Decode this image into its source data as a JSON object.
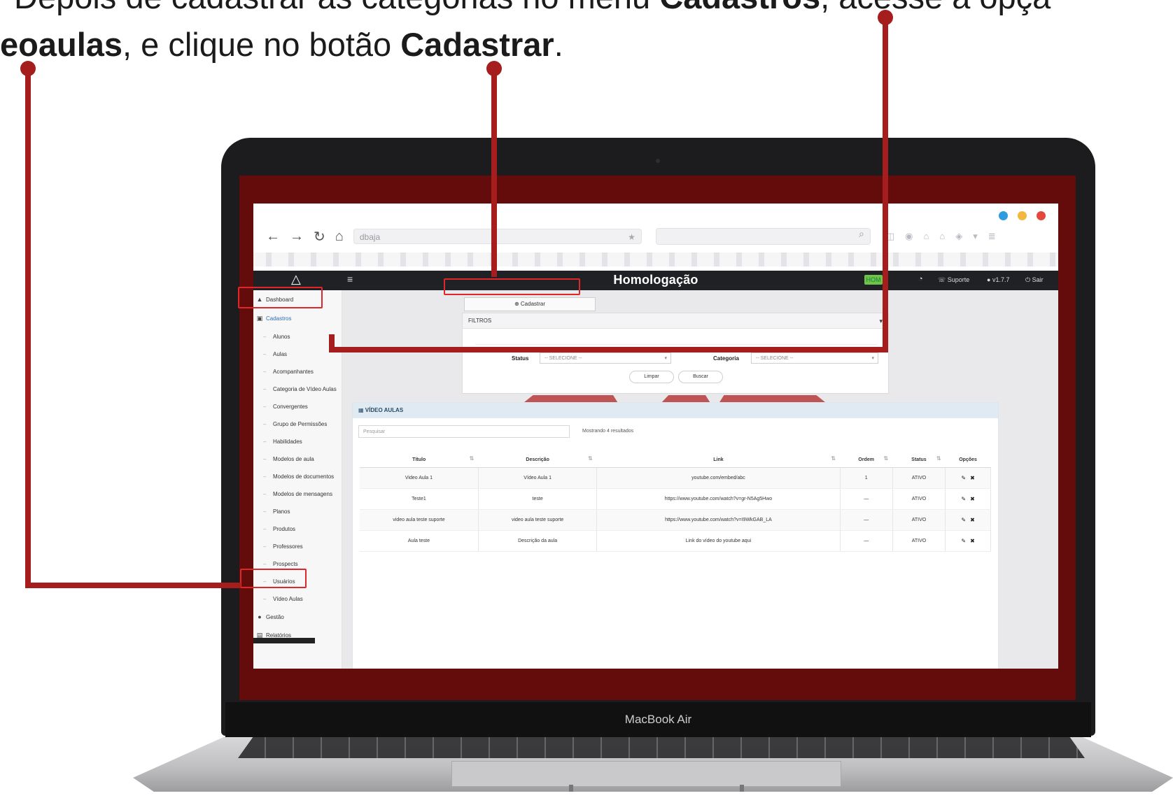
{
  "instruction": {
    "line1_pre": "Depois de cadastrar as categorias no menu ",
    "line1_bold": "Cadastros",
    "line1_post": ", acesse a opçã",
    "line2_bold1": "eoaulas",
    "line2_mid": ", e clique no botão ",
    "line2_bold2": "Cadastrar",
    "line2_post": "."
  },
  "device": {
    "caption": "MacBook Air"
  },
  "browser": {
    "url": "dbaja",
    "window_dot_colors": [
      "#2f9be0",
      "#f3b73d",
      "#e5473b"
    ]
  },
  "app": {
    "title": "Homologação",
    "env_badge": "HOM",
    "support": "Suporte",
    "version": "v1.7.7",
    "exit": "Sair"
  },
  "sidebar": {
    "dashboard": "Dashboard",
    "cadastros": "Cadastros",
    "sub_items": [
      "Alunos",
      "Aulas",
      "Acompanhantes",
      "Categoria de Vídeo Aulas",
      "Convergentes",
      "Grupo de Permissões",
      "Habilidades",
      "Modelos de aula",
      "Modelos de documentos",
      "Modelos de mensagens",
      "Planos",
      "Produtos",
      "Professores",
      "Prospects",
      "Usuários",
      "Vídeo Aulas"
    ],
    "gestao": "Gestão",
    "relatorios": "Relatórios"
  },
  "main": {
    "cadastrar_button": "Cadastrar",
    "filter_title": "FILTROS",
    "status_label": "Status",
    "status_placeholder": "-- SELECIONE --",
    "categoria_label": "Categoria",
    "categoria_placeholder": "-- SELECIONE --",
    "limpar_button": "Limpar",
    "buscar_button": "Buscar",
    "list_title": "VÍDEO AULAS",
    "search_placeholder": "Pesquisar",
    "results_info": "Mostrando 4 resultados",
    "columns": [
      "Título",
      "Descrição",
      "Link",
      "Ordem",
      "Status",
      "Opções"
    ],
    "rows": [
      [
        "Video Aula 1",
        "Vídeo Aula 1",
        "youtube.com/embed/abc",
        "1",
        "ATIVO"
      ],
      [
        "Teste1",
        "teste",
        "https://www.youtube.com/watch?v=gr-N5Ag5Hwo",
        "—",
        "ATIVO"
      ],
      [
        "video aula teste suporte",
        "video aula teste suporte",
        "https://www.youtube.com/watch?v=I9WkGAB_LA",
        "—",
        "ATIVO"
      ],
      [
        "Aula teste",
        "Descrição da aula",
        "Link do vídeo do youtube aqui",
        "—",
        "ATIVO"
      ]
    ]
  },
  "colors": {
    "callout": "#a51d1d",
    "highlight": "#e0262b",
    "screen_frame": "#640b0b"
  }
}
